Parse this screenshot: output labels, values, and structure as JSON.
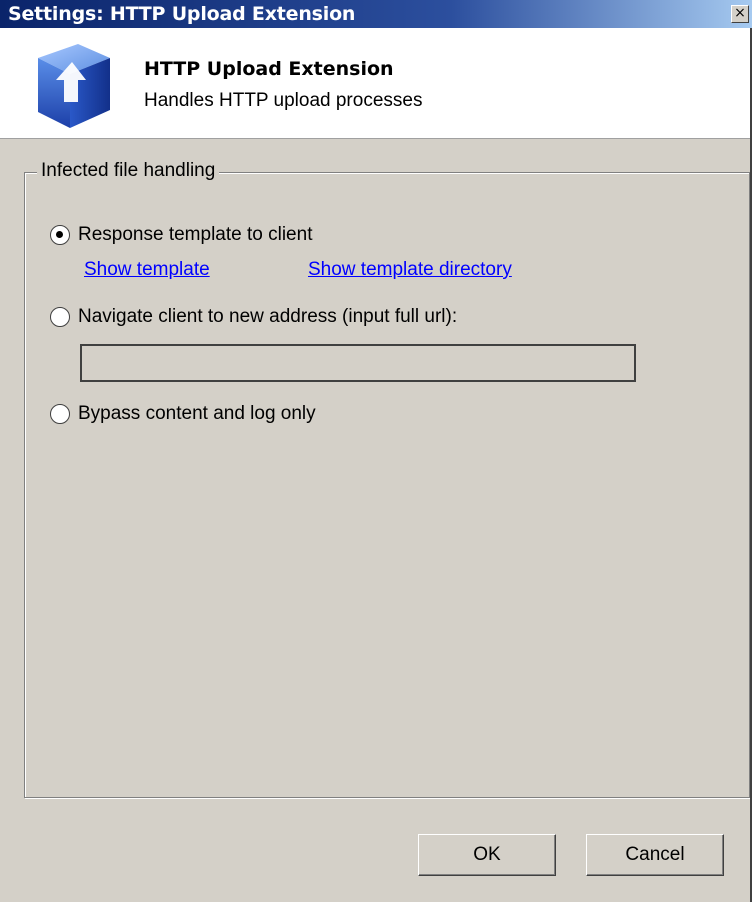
{
  "window": {
    "title": "Settings: HTTP Upload Extension",
    "close_glyph": "×"
  },
  "header": {
    "icon": "blue-cube-upload-arrow-icon",
    "title": "HTTP Upload Extension",
    "subtitle": "Handles HTTP upload processes"
  },
  "group": {
    "legend": "Infected file handling",
    "options": [
      {
        "label": "Response template to client",
        "selected": true
      },
      {
        "label": "Navigate client to new address (input full url):",
        "selected": false
      },
      {
        "label": "Bypass content and log only",
        "selected": false
      }
    ],
    "links": {
      "show_template": "Show template",
      "show_template_directory": "Show template directory"
    },
    "url_input": {
      "value": "",
      "placeholder": ""
    }
  },
  "buttons": {
    "ok": "OK",
    "cancel": "Cancel"
  },
  "colors": {
    "titlebar": "#0a246a",
    "dialog_bg": "#d4d0c8",
    "link": "#0000ff"
  }
}
